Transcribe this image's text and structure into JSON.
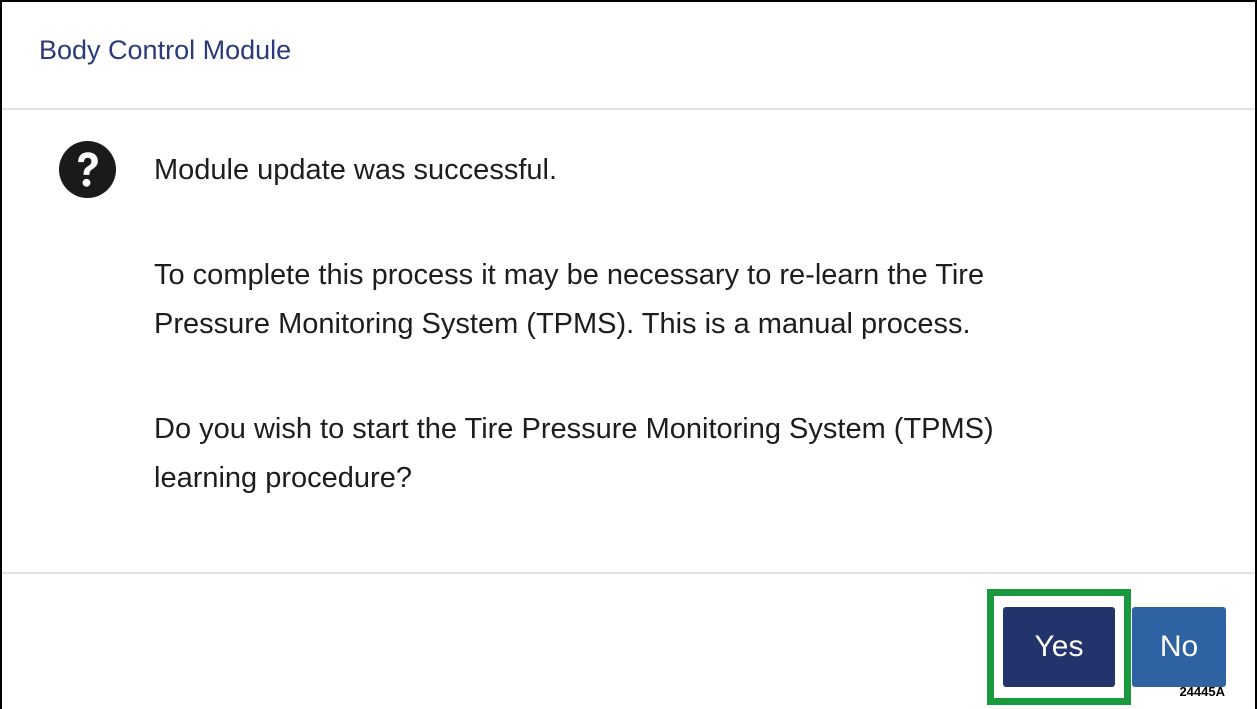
{
  "dialog": {
    "title": "Body Control Module",
    "icon": "question-circle-icon",
    "message_line1": "Module update was successful.",
    "paragraph2_line1": "To complete this process it may be necessary to re-learn the Tire",
    "paragraph2_line2": "Pressure Monitoring System (TPMS). This is a manual process.",
    "paragraph3_line1": "Do you wish to start the Tire Pressure Monitoring System (TPMS)",
    "paragraph3_line2": "learning procedure?"
  },
  "buttons": {
    "yes_label": "Yes",
    "no_label": "No"
  },
  "figure_id": "24445A",
  "colors": {
    "title": "#2b3a7a",
    "yes_button": "#23336b",
    "no_button": "#2e62a3",
    "highlight": "#1a9a3f"
  }
}
